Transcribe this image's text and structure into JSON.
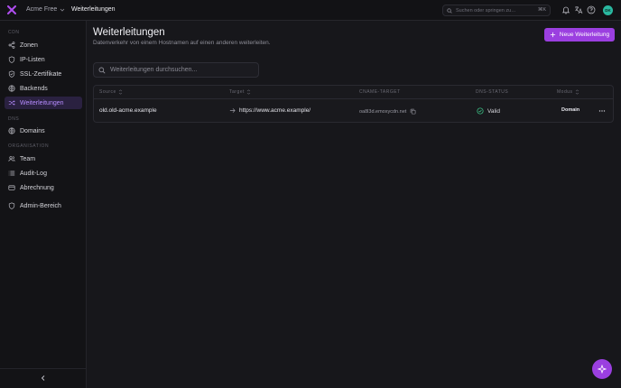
{
  "header": {
    "org_name": "Acme Free",
    "breadcrumb": "Weiterleitungen",
    "search_placeholder": "Suchen oder springen zu…",
    "search_shortcut": "⌘K",
    "avatar_initials": "DK"
  },
  "sidebar": {
    "sections": [
      {
        "label": "CDN",
        "items": [
          {
            "label": "Zonen",
            "icon": "share-icon",
            "active": false
          },
          {
            "label": "IP-Listen",
            "icon": "shield-icon",
            "active": false
          },
          {
            "label": "SSL-Zertifikate",
            "icon": "shield-check-icon",
            "active": false
          },
          {
            "label": "Backends",
            "icon": "globe-icon",
            "active": false
          },
          {
            "label": "Weiterleitungen",
            "icon": "shuffle-icon",
            "active": true
          }
        ]
      },
      {
        "label": "DNS",
        "items": [
          {
            "label": "Domains",
            "icon": "globe-icon",
            "active": false
          }
        ]
      },
      {
        "label": "ORGANISATION",
        "items": [
          {
            "label": "Team",
            "icon": "users-icon",
            "active": false
          },
          {
            "label": "Audit-Log",
            "icon": "list-icon",
            "active": false
          },
          {
            "label": "Abrechnung",
            "icon": "credit-card-icon",
            "active": false
          }
        ]
      },
      {
        "label": "",
        "items": [
          {
            "label": "Admin-Bereich",
            "icon": "shield-icon",
            "active": false
          }
        ]
      }
    ]
  },
  "main": {
    "title": "Weiterleitungen",
    "subtitle": "Datenverkehr von einem Hostnamen auf einen anderen weiterleiten.",
    "new_button": "Neue Weiterleitung",
    "filter_placeholder": "Weiterleitungen durchsuchen...",
    "columns": [
      "Source",
      "Target",
      "CNAME-TARGET",
      "DNS-STATUS",
      "Modus"
    ],
    "rows": [
      {
        "source": "old.old-acme.example",
        "target": "https://www.acme.example/",
        "cname": "oa8l3d.emoxycdn.net",
        "dns_status": "Valid",
        "mode": "Domain"
      }
    ]
  },
  "colors": {
    "accent": "#9b3fe0",
    "active_nav_text": "#b78cff",
    "valid": "#3fcf8e"
  }
}
